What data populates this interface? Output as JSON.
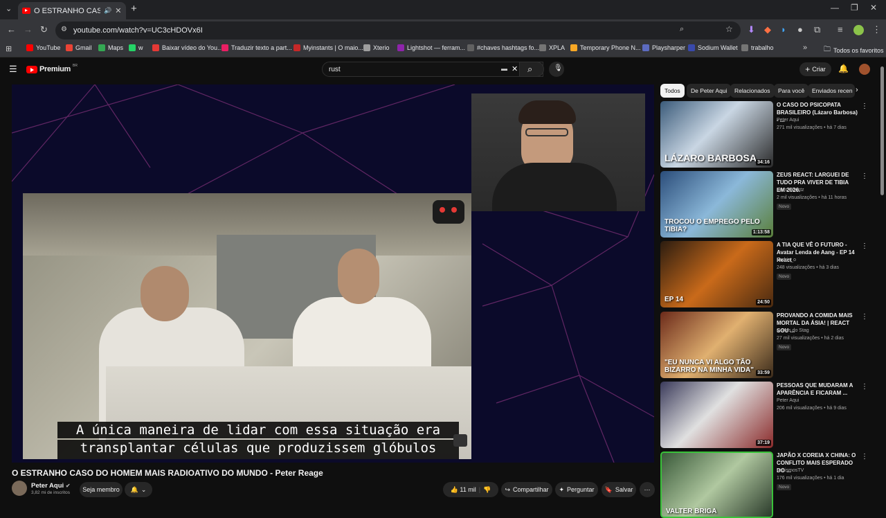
{
  "browser": {
    "tab_title": "O ESTRANHO CASO DO HO",
    "url": "youtube.com/watch?v=UC3cHDOVx6I",
    "bookmarks": [
      {
        "label": "YouTube",
        "color": "#ff0000"
      },
      {
        "label": "Gmail",
        "color": "#ea4335"
      },
      {
        "label": "Maps",
        "color": "#34a853"
      },
      {
        "label": "w",
        "color": "#25d366"
      },
      {
        "label": "Baixar vídeo do You...",
        "color": "#e53935"
      },
      {
        "label": "Traduzir texto a part...",
        "color": "#e91e63"
      },
      {
        "label": "Myinstants | O maio...",
        "color": "#c62828"
      },
      {
        "label": "Xterio",
        "color": "#9e9e9e"
      },
      {
        "label": "Lightshot — ferram...",
        "color": "#8e24aa"
      },
      {
        "label": "#chaves hashtags fo...",
        "color": "#616161"
      },
      {
        "label": "XPLA",
        "color": "#757575"
      },
      {
        "label": "Temporary Phone N...",
        "color": "#f9a825"
      },
      {
        "label": "Playsharper",
        "color": "#5c6bc0"
      },
      {
        "label": "Sodium Wallet",
        "color": "#3949ab"
      },
      {
        "label": "trabalho",
        "color": "#757575"
      }
    ],
    "all_bookmarks_label": "Todos os favoritos"
  },
  "youtube": {
    "logo_text": "Premium",
    "logo_sup": "BR",
    "search_query": "rust",
    "create_label": "Criar"
  },
  "video": {
    "subtitle_line1": "A única maneira de lidar com essa situação era",
    "subtitle_line2": "transplantar células que produzissem glóbulos brancos.",
    "title": "O ESTRANHO CASO DO HOMEM MAIS RADIOATIVO DO MUNDO - Peter Reage",
    "channel": "Peter Aqui",
    "subscribers": "3,82 mi de inscritos",
    "join_label": "Seja membro",
    "likes": "11 mil",
    "share_label": "Compartilhar",
    "ask_label": "Perguntar",
    "save_label": "Salvar"
  },
  "sidebar": {
    "chips": [
      "Todos",
      "De Peter Aqui",
      "Relacionados",
      "Para você",
      "Enviados recen"
    ],
    "cards": [
      {
        "title": "O CASO DO PSICOPATA BRASILEIRO (Lázaro Barbosa) - ...",
        "channel": "Peter Aqui",
        "meta": "271 mil visualizações • há 7 dias",
        "duration": "34:16",
        "badge": "",
        "thumb_text": "LÁZARO BARBOSA"
      },
      {
        "title": "ZEUS REACT: LARGUEI DE TUDO PRA VIVER DE TIBIA EM 2026.",
        "channel": "Zeus Ghostz",
        "meta": "2 mil visualizações • há 11 horas",
        "duration": "1:13:58",
        "badge": "Novo",
        "thumb_text": "TROCOU O EMPREGO PELO TIBIA?"
      },
      {
        "title": "A TIA QUE VÊ O FUTURO - Avatar Lenda de Aang - EP 14 React",
        "channel": "Endrio_o",
        "meta": "248 visualizações • há 3 dias",
        "duration": "24:50",
        "badge": "Novo",
        "thumb_text": "EP 14"
      },
      {
        "title": "PROVANDO A COMIDA MAIS MORTAL DA ÁSIA! | REACT SOU ...",
        "channel": "Cortes do Stag",
        "meta": "27 mil visualizações • há 2 dias",
        "duration": "33:59",
        "badge": "Novo",
        "thumb_text": "\"EU NUNCA VI ALGO TÃO BIZARRO NA MINHA VIDA\""
      },
      {
        "title": "PESSOAS QUE MUDARAM A APARÊNCIA E FICARAM ...",
        "channel": "Peter Aqui",
        "meta": "206 mil visualizações • há 9 dias",
        "duration": "37:19",
        "badge": "",
        "thumb_text": ""
      },
      {
        "title": "JAPÃO X COREIA X CHINA: O CONFLITO MAIS ESPERADO DO ...",
        "channel": "AchismosTV",
        "meta": "176 mil visualizações • há 1 dia",
        "duration": "",
        "badge": "Novo",
        "thumb_text": "VALTER BRIGA"
      }
    ]
  }
}
